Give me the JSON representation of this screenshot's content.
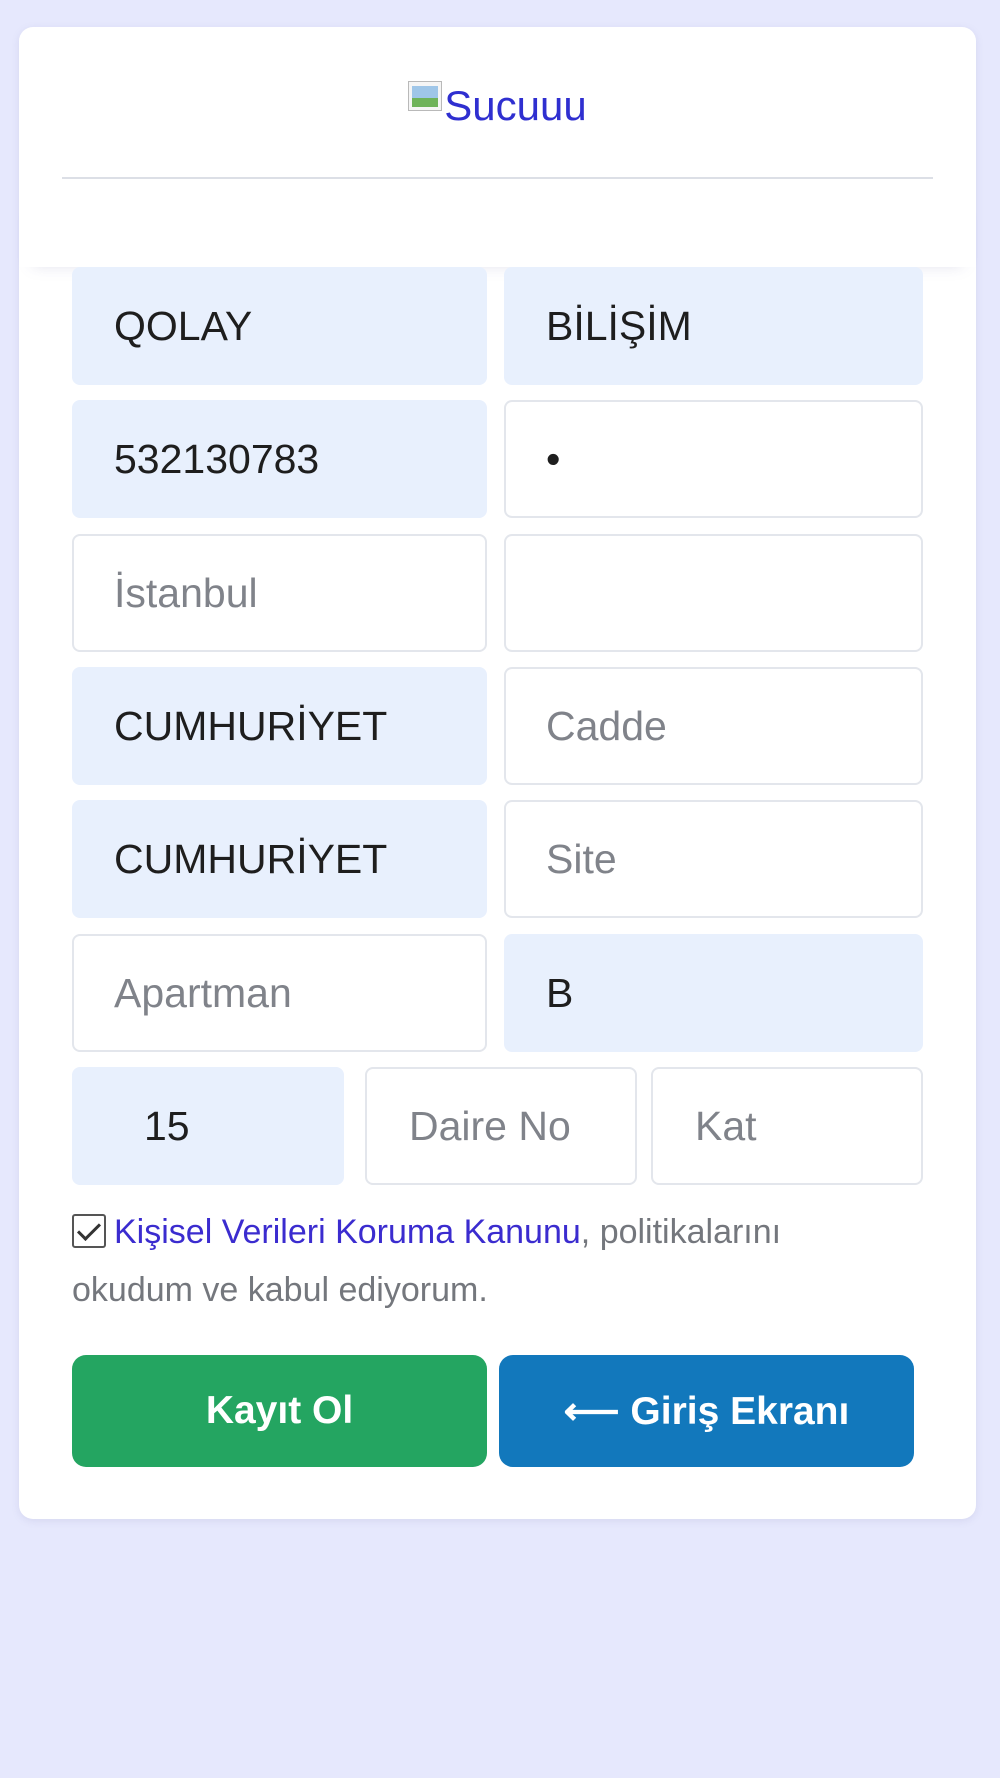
{
  "logo": {
    "alt_text": "Sucuuu"
  },
  "fields": {
    "first_name": {
      "value": "QOLAY",
      "placeholder": ""
    },
    "last_name": {
      "value": "BİLİŞİM",
      "placeholder": ""
    },
    "phone": {
      "value": "532130783",
      "placeholder": ""
    },
    "password": {
      "value": "•",
      "placeholder": ""
    },
    "city": {
      "value": "",
      "placeholder": "İstanbul"
    },
    "district": {
      "value": "",
      "placeholder": ""
    },
    "neighborhood": {
      "value": "CUMHURİYET",
      "placeholder": ""
    },
    "street": {
      "value": "",
      "placeholder": "Cadde"
    },
    "avenue": {
      "value": "CUMHURİYET",
      "placeholder": ""
    },
    "site": {
      "value": "",
      "placeholder": "Site"
    },
    "apartment": {
      "value": "",
      "placeholder": "Apartman"
    },
    "block": {
      "value": "B",
      "placeholder": ""
    },
    "building_no": {
      "value": "15",
      "placeholder": ""
    },
    "flat_no": {
      "value": "",
      "placeholder": "Daire No"
    },
    "floor": {
      "value": "",
      "placeholder": "Kat"
    }
  },
  "consent": {
    "link_text": "Kişisel Verileri Koruma Kanunu",
    "text": ", politikalarını okudum ve kabul ediyorum.",
    "checked": true
  },
  "buttons": {
    "register_label": "Kayıt Ol",
    "login_label": "⟵ Giriş Ekranı"
  },
  "colors": {
    "page_bg": "#e6e8fd",
    "filled_field_bg": "#e8f0fd",
    "register_button": "#24a561",
    "login_button": "#1278bc",
    "link": "#3b2ccf"
  }
}
